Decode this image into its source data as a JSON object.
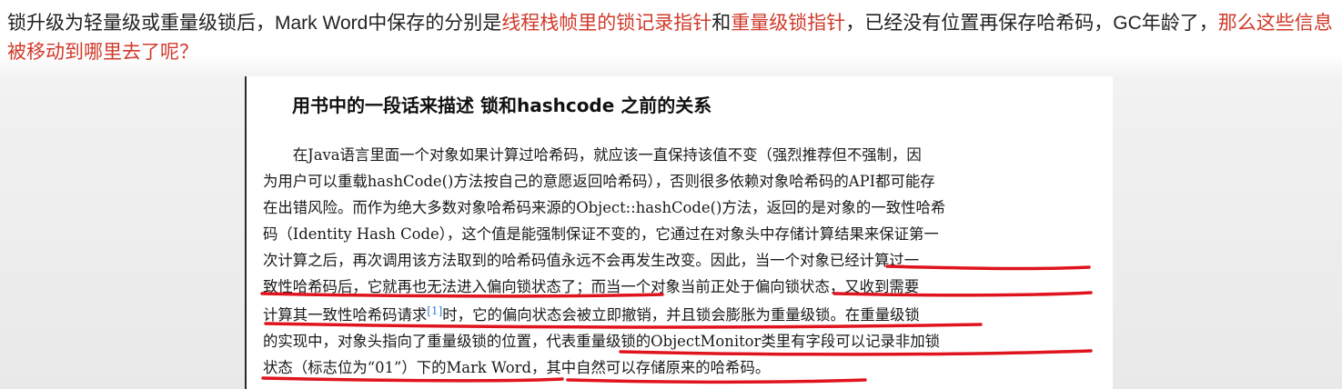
{
  "question": {
    "part1": "锁升级为轻量级或重量级锁后，Mark Word中保存的分别是",
    "part2": "线程栈帧里的锁记录指针",
    "part3": "和",
    "part4": "重量级锁指针",
    "part5": "，已经没有位置再保存哈希码，GC年龄了，",
    "part6": "那么这些信息被移动到哪里去了呢？"
  },
  "book": {
    "heading": "用书中的一段话来描述 锁和hashcode 之前的关系",
    "lines": [
      "　　在Java语言里面一个对象如果计算过哈希码，就应该一直保持该值不变（强烈推荐但不强制，因",
      "为用户可以重载hashCode()方法按自己的意愿返回哈希码），否则很多依赖对象哈希码的API都可能存",
      "在出错风险。而作为绝大多数对象哈希码来源的Object::hashCode()方法，返回的是对象的一致性哈希",
      "码（Identity Hash Code），这个值是能强制保证不变的，它通过在对象头中存储计算结果来保证第一",
      "次计算之后，再次调用该方法取到的哈希码值永远不会再发生改变。因此，当一个对象已经计算过一",
      "致性哈希码后，它就再也无法进入偏向锁状态了；而当一个对象当前正处于偏向锁状态，又收到需要"
    ],
    "line7_a": "计算其一致性哈希码请求",
    "line7_sup": "[1]",
    "line7_b": "时，它的偏向状态会被立即撤销，并且锁会膨胀为重量级锁。在重量级锁",
    "line8": "的实现中，对象头指向了重量级锁的位置，代表重量级锁的ObjectMonitor类里有字段可以记录非加锁",
    "line9": "状态（标志位为“01”）下的Mark Word，其中自然可以存储原来的哈希码。"
  },
  "colors": {
    "highlight_red": "#d03a2b",
    "underline_red": "#e0141e",
    "link_blue": "#3a7bd5"
  }
}
